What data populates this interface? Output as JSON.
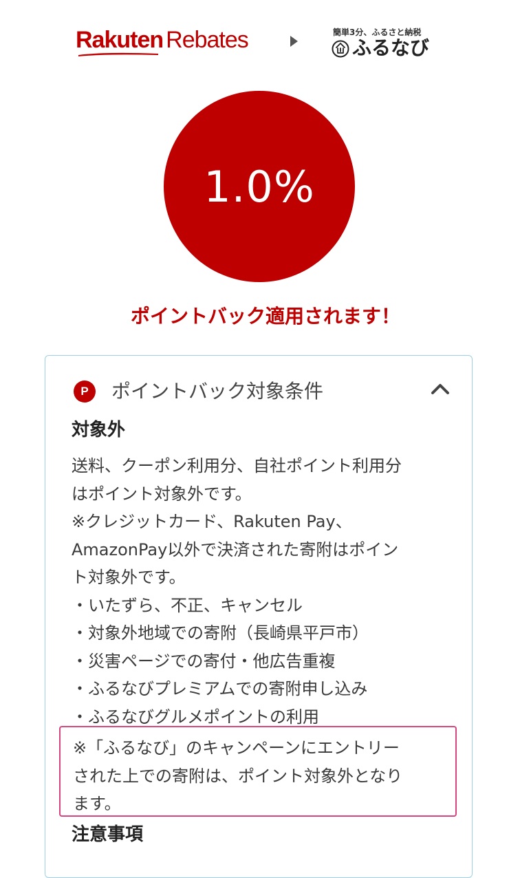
{
  "header": {
    "rakuten_strong": "Rakuten",
    "rakuten_light": "Rebates",
    "furunavi_tagline": "簡単3分、ふるさと納税",
    "furunavi_name": "ふるなび"
  },
  "rate": {
    "value": "1.0%"
  },
  "applied_message": "ポイントバック適用されます！",
  "conditions": {
    "badge": "P",
    "title": "ポイントバック対象条件",
    "exclusion_heading": "対象外",
    "exclusion_lines": [
      "送料、クーポン利用分、自社ポイント利用分",
      "はポイント対象外です。",
      "※クレジットカード、Rakuten Pay、",
      "AmazonPay以外で決済された寄附はポイン",
      "ト対象外です。",
      "・いたずら、不正、キャンセル",
      "・対象外地域での寄附（長崎県平戸市）",
      "・災害ページでの寄付・他広告重複",
      "・ふるなびプレミアムでの寄附申し込み",
      "・ふるなびグルメポイントの利用"
    ],
    "campaign_note_lines": [
      "※「ふるなび」のキャンペーンにエントリー",
      "された上での寄附は、ポイント対象外となり",
      "ます。"
    ],
    "notes_heading": "注意事項"
  },
  "colors": {
    "rakuten_red": "#bf0000",
    "panel_border": "#9dd0e6",
    "highlight_border": "#d6457e"
  }
}
